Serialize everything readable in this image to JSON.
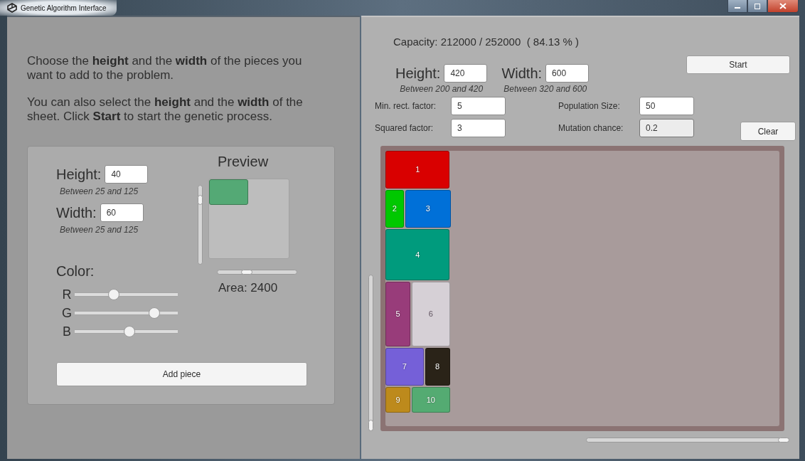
{
  "window": {
    "title": "Genetic Algorithm Interface"
  },
  "instructions": [
    "Choose the **height** and the **width** of the pieces you want to add to the problem.",
    "You can also select the **height** and the **width** of the sheet. Click **Start** to start the genetic process."
  ],
  "piece_editor": {
    "fields": [
      {
        "label": "Height:",
        "value": "40",
        "hint": "Between 25 and 125"
      },
      {
        "label": "Width:",
        "value": "60",
        "hint": "Between 25 and 125"
      }
    ],
    "color_label": "Color:",
    "channels": [
      {
        "label": "R",
        "level": 0.38
      },
      {
        "label": "G",
        "level": 0.77
      },
      {
        "label": "B",
        "level": 0.53
      }
    ],
    "preview": {
      "title": "Preview",
      "area": "Area: 2400"
    },
    "add_button": "Add piece"
  },
  "sheet": {
    "capacity": "Capacity: 212000 / 252000  ( 84.13 % )",
    "fields": [
      {
        "label": "Height:",
        "value": "420",
        "hint": "Between 200 and 420"
      },
      {
        "label": "Width:",
        "value": "600",
        "hint": "Between 320 and 600"
      }
    ],
    "start_button": "Start",
    "parameters": [
      {
        "label": "Min. rect. factor:",
        "value": "5",
        "focused": false
      },
      {
        "label": "Population Size:",
        "value": "50",
        "focused": false
      },
      {
        "label": "Squared factor:",
        "value": "3",
        "focused": false
      },
      {
        "label": "Mutation chance:",
        "value": "0.2",
        "focused": true
      }
    ],
    "clear_button": "Clear",
    "rows": [
      {
        "pieces": [
          {
            "label": "1",
            "color": "#d90000"
          }
        ]
      },
      {
        "pieces": [
          {
            "label": "2",
            "color": "#00c800"
          },
          {
            "label": "3",
            "color": "#0070d8"
          }
        ]
      },
      {
        "pieces": [
          {
            "label": "4",
            "color": "#009b7d"
          }
        ]
      },
      {
        "pieces": [
          {
            "label": "5",
            "color": "#983c7a"
          },
          {
            "label": "6",
            "color": "#d6d0d6"
          }
        ]
      },
      {
        "pieces": [
          {
            "label": "7",
            "color": "#7560d8"
          },
          {
            "label": "8",
            "color": "#2a2318"
          }
        ]
      },
      {
        "pieces": [
          {
            "label": "9",
            "color": "#bd8a1c"
          },
          {
            "label": "10",
            "color": "#54ab72"
          }
        ]
      }
    ]
  }
}
